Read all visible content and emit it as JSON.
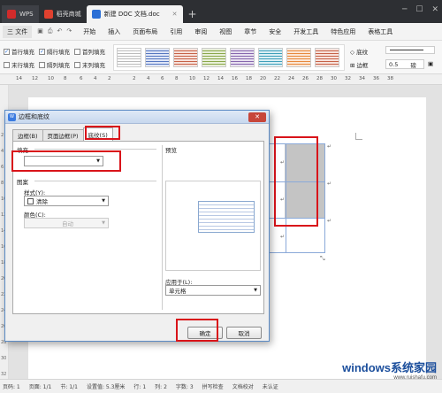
{
  "titlebar": {
    "wps_label": "WPS",
    "tab_store": "稻壳商城",
    "tab_doc": "新建 DOC 文档.doc"
  },
  "menubar": {
    "file": "三 文件",
    "items": [
      "开始",
      "插入",
      "页面布局",
      "引用",
      "审阅",
      "视图",
      "章节",
      "安全",
      "开发工具",
      "特色应用",
      "表格工具"
    ]
  },
  "ribbon": {
    "checks": [
      {
        "label": "首行填充",
        "checked": true
      },
      {
        "label": "隔行填充",
        "checked": true
      },
      {
        "label": "首列填充",
        "checked": false
      },
      {
        "label": "末行填充",
        "checked": false
      },
      {
        "label": "隔列填充",
        "checked": false
      },
      {
        "label": "末列填充",
        "checked": false
      }
    ],
    "shading_label": "底纹",
    "border_label": "边框",
    "line_width": "0.5",
    "line_unit": "磅"
  },
  "ruler": {
    "h_ticks": [
      "14",
      "12",
      "10",
      "8",
      "6",
      "4",
      "2",
      "2",
      "4",
      "6",
      "8",
      "10",
      "12",
      "14",
      "16",
      "18",
      "20",
      "22",
      "24",
      "26",
      "28",
      "30",
      "32",
      "34",
      "36",
      "38"
    ],
    "v_ticks": [
      "2",
      "4",
      "6",
      "8",
      "10",
      "12",
      "14",
      "16",
      "18",
      "20",
      "22",
      "24",
      "26",
      "28",
      "30",
      "32"
    ]
  },
  "doc": {
    "cell_mark": "↵"
  },
  "dialog": {
    "title": "边框和底纹",
    "tabs": [
      "边框(B)",
      "页面边框(P)",
      "底纹(S)"
    ],
    "active_tab": 2,
    "fill_label": "填充",
    "fill_value": "",
    "pattern_label": "图案",
    "style_label": "样式(Y):",
    "style_value": "清除",
    "color_label": "颜色(C):",
    "color_value": "自动",
    "preview_label": "预览",
    "apply_label": "应用于(L):",
    "apply_value": "单元格",
    "ok": "确定",
    "cancel": "取消"
  },
  "statusbar": {
    "items": [
      "页码: 1",
      "页面: 1/1",
      "节: 1/1",
      "设置值: 5.3厘米",
      "行: 1",
      "列: 2",
      "字数: 3",
      "拼写检查",
      "文档校对",
      "未认证"
    ]
  },
  "watermark": {
    "text": "windows系统家园",
    "sub": "www.ruishafu.com"
  },
  "colors": {
    "highlight_red": "#d9141a",
    "accent_blue": "#2a6fd4"
  }
}
